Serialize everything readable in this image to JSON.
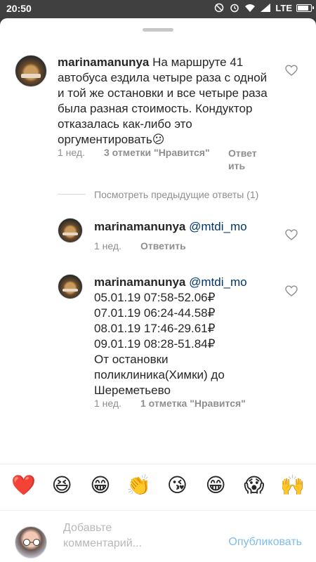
{
  "status_bar": {
    "time": "20:50",
    "network": "LTE",
    "battery_level": 0.9,
    "icons": [
      "silence-icon",
      "alarm-icon",
      "wifi-icon",
      "signal-icon",
      "battery-icon"
    ]
  },
  "comments": [
    {
      "username": "marinamanunya",
      "text": "На маршруте 41 автобуса ездила четыре раза с одной и той же остановки и все четыре раза была разная стоимость. Кондуктор отказалась как-либо это оргументировать",
      "emoji": "😕",
      "time_ago": "1 нед.",
      "likes": "3 отметки \"Нравится\"",
      "reply_line1": "Ответ",
      "reply_line2": "ить"
    }
  ],
  "view_previous": "Посмотреть предыдущие ответы (1)",
  "replies": [
    {
      "username": "marinamanunya",
      "mention": "@mtdi_mo",
      "time_ago": "1 нед.",
      "reply_label": "Ответить"
    },
    {
      "username": "marinamanunya",
      "mention": "@mtdi_mo",
      "lines": [
        "05.01.19 07:58-52.06₽",
        "07.01.19 06:24-44.58₽",
        "08.01.19 17:46-29.61₽",
        "09.01.19 08:28-51.84₽",
        "От остановки",
        "поликлиника(Химки) до",
        "Шереметьево"
      ],
      "time_ago": "1 нед.",
      "likes": "1 отметка \"Нравится\""
    }
  ],
  "emoji_bar": [
    "❤️",
    "😆",
    "😁",
    "👏",
    "😘",
    "😁",
    "😱",
    "🙌"
  ],
  "composer": {
    "placeholder": "Добавьте комментарий...",
    "publish_label": "Опубликовать"
  },
  "colors": {
    "link": "#003569",
    "publish": "#7fbcee",
    "meta": "#8e8e8e"
  }
}
